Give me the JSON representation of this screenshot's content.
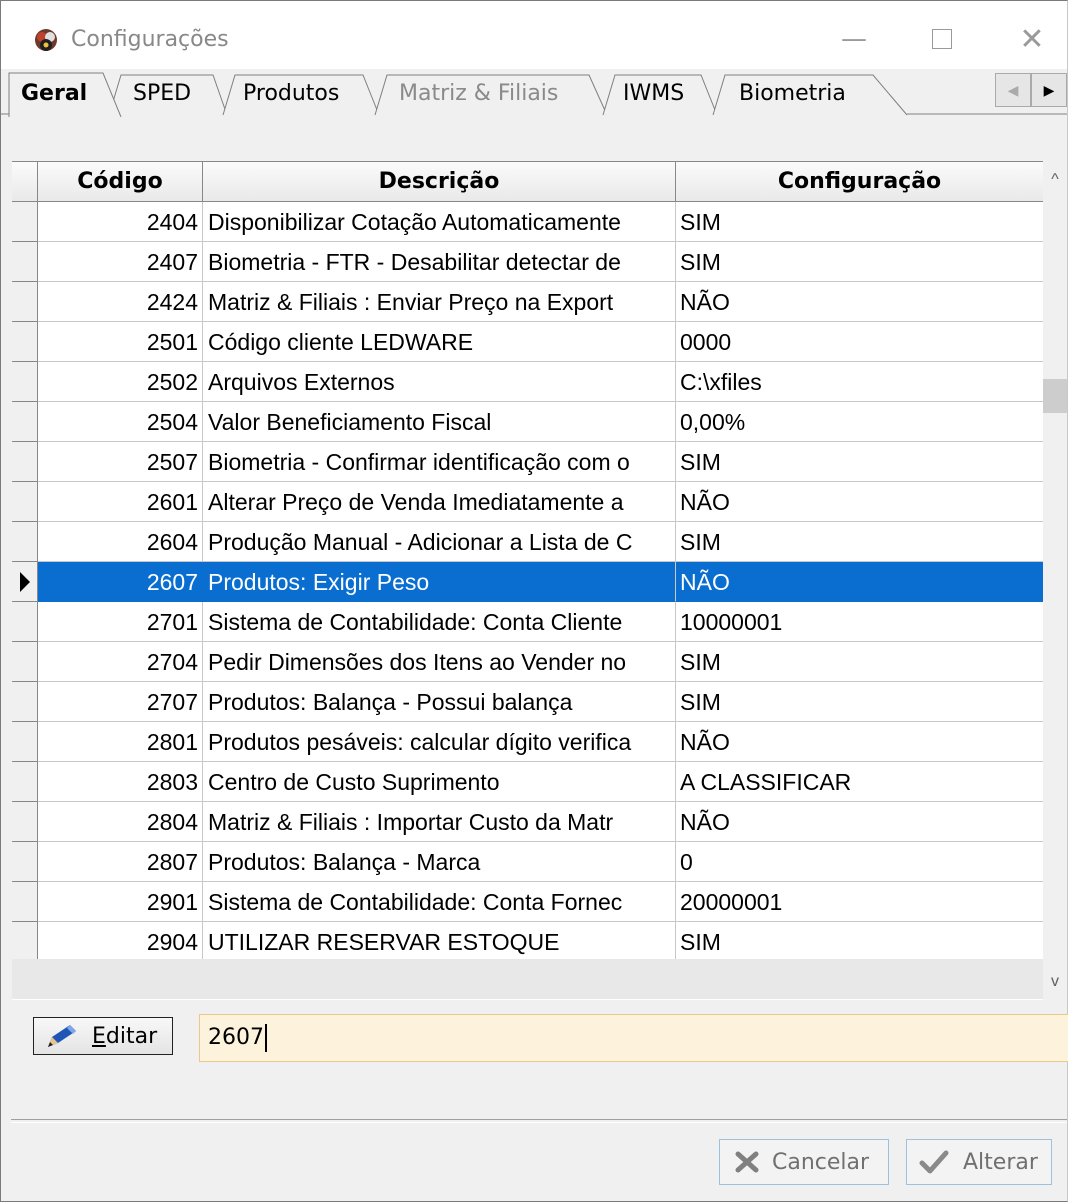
{
  "window": {
    "title": "Configurações",
    "min_glyph": "—",
    "close_glyph": "✕"
  },
  "tabs": [
    {
      "label": "Geral",
      "active": true,
      "enabled": true
    },
    {
      "label": "SPED",
      "active": false,
      "enabled": true
    },
    {
      "label": "Produtos",
      "active": false,
      "enabled": true
    },
    {
      "label": "Matriz & Filiais",
      "active": false,
      "enabled": false
    },
    {
      "label": "IWMS",
      "active": false,
      "enabled": true
    },
    {
      "label": "Biometria",
      "active": false,
      "enabled": true
    }
  ],
  "tab_scroll": {
    "left": "◀",
    "right": "▶"
  },
  "grid": {
    "headers": [
      "Código",
      "Descrição",
      "Configuração"
    ],
    "selected_code": "2607",
    "rows": [
      {
        "code": "2404",
        "desc": "Disponibilizar Cotação Automaticamente",
        "conf": "SIM"
      },
      {
        "code": "2407",
        "desc": "Biometria - FTR - Desabilitar detectar de",
        "conf": "SIM"
      },
      {
        "code": "2424",
        "desc": "Matriz & Filiais : Enviar Preço na Export",
        "conf": "NÃO"
      },
      {
        "code": "2501",
        "desc": "Código cliente LEDWARE",
        "conf": "0000"
      },
      {
        "code": "2502",
        "desc": "Arquivos Externos",
        "conf": "C:\\xfiles"
      },
      {
        "code": "2504",
        "desc": "Valor Beneficiamento Fiscal",
        "conf": "0,00%"
      },
      {
        "code": "2507",
        "desc": "Biometria - Confirmar identificação com o",
        "conf": "SIM"
      },
      {
        "code": "2601",
        "desc": "Alterar Preço de Venda Imediatamente a",
        "conf": "NÃO"
      },
      {
        "code": "2604",
        "desc": "Produção Manual - Adicionar a Lista de C",
        "conf": "SIM"
      },
      {
        "code": "2607",
        "desc": "Produtos: Exigir Peso",
        "conf": "NÃO"
      },
      {
        "code": "2701",
        "desc": "Sistema de Contabilidade: Conta Cliente",
        "conf": "10000001"
      },
      {
        "code": "2704",
        "desc": "Pedir Dimensões dos Itens ao Vender no",
        "conf": "SIM"
      },
      {
        "code": "2707",
        "desc": "Produtos: Balança - Possui balança",
        "conf": "SIM"
      },
      {
        "code": "2801",
        "desc": "Produtos pesáveis: calcular dígito verifica",
        "conf": "NÃO"
      },
      {
        "code": "2803",
        "desc": "Centro de Custo Suprimento",
        "conf": "A CLASSIFICAR"
      },
      {
        "code": "2804",
        "desc": "Matriz & Filiais : Importar Custo da Matr",
        "conf": "NÃO"
      },
      {
        "code": "2807",
        "desc": "Produtos: Balança - Marca",
        "conf": "0"
      },
      {
        "code": "2901",
        "desc": "Sistema de Contabilidade: Conta Fornec",
        "conf": "20000001"
      },
      {
        "code": "2904",
        "desc": "UTILIZAR RESERVAR ESTOQUE",
        "conf": "SIM"
      }
    ]
  },
  "scroll": {
    "up": "^",
    "down": "v"
  },
  "edit": {
    "button_label_underlined": "E",
    "button_label_rest": "ditar",
    "code_value": "2607"
  },
  "footer": {
    "cancel_label": "Cancelar",
    "alter_label": "Alterar"
  },
  "colors": {
    "selection": "#0a6ed1",
    "input_bg": "#fdf2dc"
  }
}
